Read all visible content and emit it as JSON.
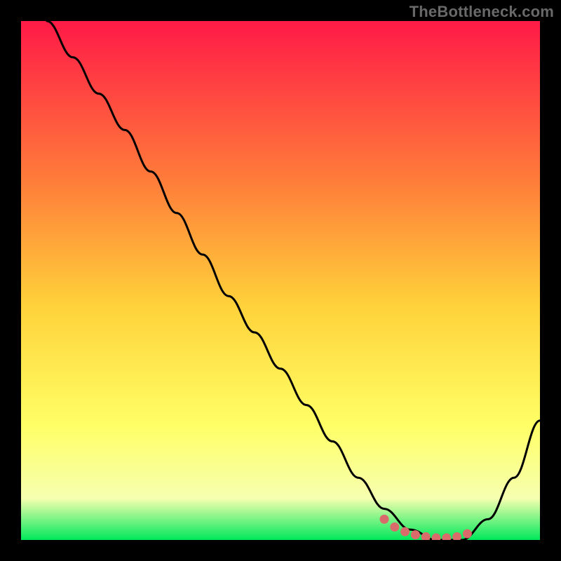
{
  "watermark": "TheBottleneck.com",
  "colors": {
    "gradient_top": "#ff1a47",
    "gradient_mid_upper": "#ff7a3a",
    "gradient_mid": "#ffd23a",
    "gradient_mid_lower": "#ffff66",
    "gradient_lower": "#f6ffb0",
    "gradient_bottom": "#00e85a",
    "curve": "#000000",
    "marker": "#d96b6b",
    "frame": "#000000"
  },
  "chart_data": {
    "type": "line",
    "title": "",
    "xlabel": "",
    "ylabel": "",
    "xlim": [
      0,
      100
    ],
    "ylim": [
      0,
      100
    ],
    "series": [
      {
        "name": "bottleneck-curve",
        "x": [
          5,
          10,
          15,
          20,
          25,
          30,
          35,
          40,
          45,
          50,
          55,
          60,
          65,
          70,
          75,
          80,
          85,
          90,
          95,
          100
        ],
        "y": [
          100,
          93,
          86,
          79,
          71,
          63,
          55,
          47,
          40,
          33,
          26,
          19,
          12,
          6,
          2,
          0,
          0,
          4,
          12,
          23
        ]
      }
    ],
    "markers": {
      "name": "optimal-range",
      "x": [
        70,
        72,
        74,
        76,
        78,
        80,
        82,
        84,
        86
      ],
      "y": [
        4,
        2.5,
        1.6,
        1,
        0.6,
        0.4,
        0.4,
        0.6,
        1.2
      ]
    }
  }
}
